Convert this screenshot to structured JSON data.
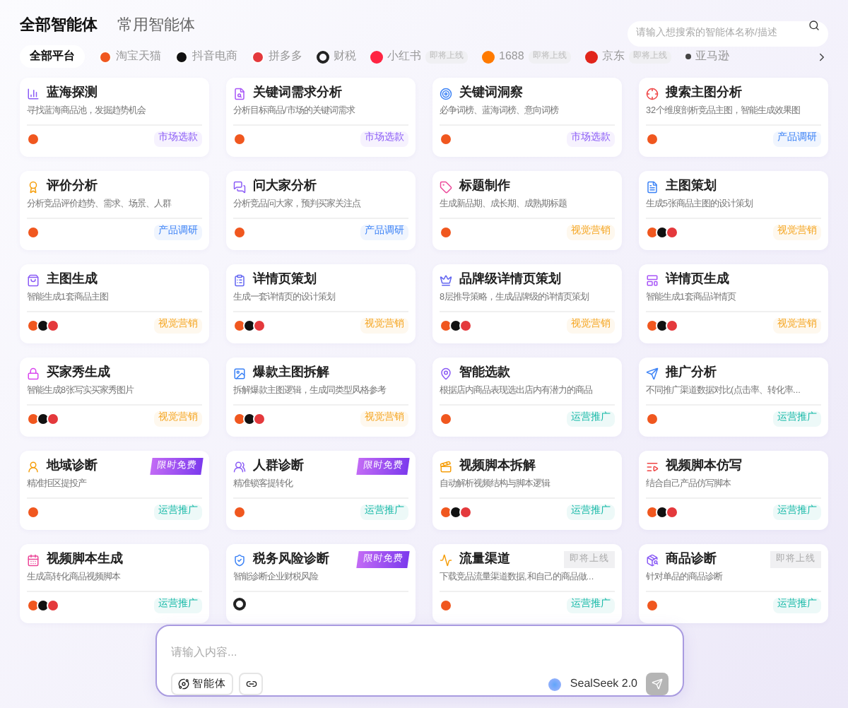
{
  "header_tabs": [
    {
      "label": "全部智能体",
      "selected": true
    },
    {
      "label": "常用智能体",
      "selected": false
    }
  ],
  "search": {
    "placeholder": "请输入想搜索的智能体名称/描述"
  },
  "platform_tabs": [
    {
      "label": "全部平台",
      "selected": true,
      "kind": "all"
    },
    {
      "label": "淘宝天猫",
      "selected": false,
      "kind": "taobao"
    },
    {
      "label": "抖音电商",
      "selected": false,
      "kind": "douyin"
    },
    {
      "label": "拼多多",
      "selected": false,
      "kind": "pdd"
    },
    {
      "label": "财税",
      "selected": false,
      "kind": "tax"
    },
    {
      "label": "小红书",
      "selected": false,
      "kind": "xhs",
      "badge": "即将上线"
    },
    {
      "label": "1688",
      "selected": false,
      "kind": "alibaba",
      "badge": "即将上线"
    },
    {
      "label": "京东",
      "selected": false,
      "kind": "jd",
      "badge": "即将上线"
    },
    {
      "label": "亚马逊",
      "selected": false,
      "kind": "amazon"
    }
  ],
  "cards": [
    {
      "title": "蓝海探测",
      "desc": "寻找蓝海商品池，发掘趋势机会",
      "platforms": [
        {
          "kind": "taobao"
        }
      ],
      "tag": {
        "text": "市场选款",
        "color": "#8b5cf6"
      }
    },
    {
      "title": "关键词需求分析",
      "desc": "分析目标商品/市场的关键词需求",
      "platforms": [
        {
          "kind": "taobao"
        }
      ],
      "tag": {
        "text": "市场选款",
        "color": "#8b5cf6"
      }
    },
    {
      "title": "关键词洞察",
      "desc": "必争词榜、蓝海词榜、意向词榜",
      "platforms": [
        {
          "kind": "taobao"
        }
      ],
      "tag": {
        "text": "市场选款",
        "color": "#8b5cf6"
      }
    },
    {
      "title": "搜索主图分析",
      "desc": "32个维度剖析竞品主图，智能生成效果图",
      "platforms": [
        {
          "kind": "taobao"
        }
      ],
      "tag": {
        "text": "产品调研",
        "color": "#3b82f6"
      }
    },
    {
      "title": "评价分析",
      "desc": "分析竞品评价趋势、需求、场景、人群",
      "platforms": [
        {
          "kind": "taobao"
        }
      ],
      "tag": {
        "text": "产品调研",
        "color": "#3b82f6"
      }
    },
    {
      "title": "问大家分析",
      "desc": "分析竞品问大家，预判买家关注点",
      "platforms": [
        {
          "kind": "taobao"
        }
      ],
      "tag": {
        "text": "产品调研",
        "color": "#3b82f6"
      }
    },
    {
      "title": "标题制作",
      "desc": "生成新品期、成长期、成熟期标题",
      "platforms": [
        {
          "kind": "taobao"
        }
      ],
      "tag": {
        "text": "视觉营销",
        "color": "#f5a623"
      }
    },
    {
      "title": "主图策划",
      "desc": "生成5张商品主图的设计策划",
      "platforms": [
        {
          "kind": "taobao"
        },
        {
          "kind": "douyin"
        },
        {
          "kind": "pdd"
        }
      ],
      "tag": {
        "text": "视觉营销",
        "color": "#f5a623"
      }
    },
    {
      "title": "主图生成",
      "desc": "智能生成1套商品主图",
      "platforms": [
        {
          "kind": "taobao"
        },
        {
          "kind": "douyin"
        },
        {
          "kind": "pdd"
        }
      ],
      "tag": {
        "text": "视觉营销",
        "color": "#f5a623"
      }
    },
    {
      "title": "详情页策划",
      "desc": "生成一套详情页的设计策划",
      "platforms": [
        {
          "kind": "taobao"
        },
        {
          "kind": "douyin"
        },
        {
          "kind": "pdd"
        }
      ],
      "tag": {
        "text": "视觉营销",
        "color": "#f5a623"
      }
    },
    {
      "title": "品牌级详情页策划",
      "desc": "8层推导策略，生成品牌级的详情页策划",
      "platforms": [
        {
          "kind": "taobao"
        },
        {
          "kind": "douyin"
        },
        {
          "kind": "pdd"
        }
      ],
      "tag": {
        "text": "视觉营销",
        "color": "#f5a623"
      }
    },
    {
      "title": "详情页生成",
      "desc": "智能生成1套商品详情页",
      "platforms": [
        {
          "kind": "taobao"
        },
        {
          "kind": "douyin"
        },
        {
          "kind": "pdd"
        }
      ],
      "tag": {
        "text": "视觉营销",
        "color": "#f5a623"
      }
    },
    {
      "title": "买家秀生成",
      "desc": "智能生成8张写实买家秀图片",
      "platforms": [
        {
          "kind": "taobao"
        },
        {
          "kind": "douyin"
        },
        {
          "kind": "pdd"
        }
      ],
      "tag": {
        "text": "视觉营销",
        "color": "#f5a623"
      }
    },
    {
      "title": "爆款主图拆解",
      "desc": "拆解爆款主图逻辑，生成同类型风格参考",
      "platforms": [
        {
          "kind": "taobao"
        },
        {
          "kind": "douyin"
        },
        {
          "kind": "pdd"
        }
      ],
      "tag": {
        "text": "视觉营销",
        "color": "#f5a623"
      }
    },
    {
      "title": "智能选款",
      "desc": "根据店内商品表现选出店内有潜力的商品",
      "platforms": [
        {
          "kind": "taobao"
        }
      ],
      "tag": {
        "text": "运营推广",
        "color": "#14b8a6"
      }
    },
    {
      "title": "推广分析",
      "desc": "不同推广渠道数据对比(点击率、转化率...",
      "platforms": [
        {
          "kind": "taobao"
        }
      ],
      "tag": {
        "text": "运营推广",
        "color": "#14b8a6"
      }
    },
    {
      "title": "地域诊断",
      "desc": "精准拒区提投产",
      "badge": {
        "text": "限时免费",
        "kind": "free"
      },
      "platforms": [
        {
          "kind": "taobao"
        }
      ],
      "tag": {
        "text": "运营推广",
        "color": "#14b8a6"
      }
    },
    {
      "title": "人群诊断",
      "desc": "精准锁客提转化",
      "badge": {
        "text": "限时免费",
        "kind": "free"
      },
      "platforms": [
        {
          "kind": "taobao"
        }
      ],
      "tag": {
        "text": "运营推广",
        "color": "#14b8a6"
      }
    },
    {
      "title": "视频脚本拆解",
      "desc": "自动解析视频结构与脚本逻辑",
      "platforms": [
        {
          "kind": "taobao"
        },
        {
          "kind": "douyin"
        },
        {
          "kind": "pdd"
        }
      ],
      "tag": {
        "text": "运营推广",
        "color": "#14b8a6"
      }
    },
    {
      "title": "视频脚本仿写",
      "desc": "结合自己产品仿写脚本",
      "platforms": [
        {
          "kind": "taobao"
        },
        {
          "kind": "douyin"
        },
        {
          "kind": "pdd"
        }
      ],
      "tag": {
        "text": "运营推广",
        "color": "#14b8a6"
      }
    },
    {
      "title": "视频脚本生成",
      "desc": "生成高转化商品视频脚本",
      "platforms": [
        {
          "kind": "taobao"
        },
        {
          "kind": "douyin"
        },
        {
          "kind": "pdd"
        }
      ],
      "tag": {
        "text": "运营推广",
        "color": "#14b8a6"
      }
    },
    {
      "title": "税务风险诊断",
      "desc": "智能诊断企业财税风险",
      "badge": {
        "text": "限时免费",
        "kind": "free"
      },
      "platforms": [
        {
          "kind": "tax"
        }
      ]
    },
    {
      "title": "流量渠道",
      "desc": "下载竞品流量渠道数据,和自己的商品做...",
      "badge": {
        "text": "即将上线",
        "kind": "soon"
      },
      "platforms": [
        {
          "kind": "taobao"
        }
      ],
      "tag": {
        "text": "运营推广",
        "color": "#14b8a6"
      }
    },
    {
      "title": "商品诊断",
      "desc": "针对单品的商品诊断",
      "badge": {
        "text": "即将上线",
        "kind": "soon"
      },
      "platforms": [
        {
          "kind": "taobao"
        }
      ],
      "tag": {
        "text": "运营推广",
        "color": "#14b8a6"
      }
    }
  ],
  "composer": {
    "placeholder": "请输入内容...",
    "agent_button": "智能体",
    "model": "SealSeek 2.0"
  }
}
